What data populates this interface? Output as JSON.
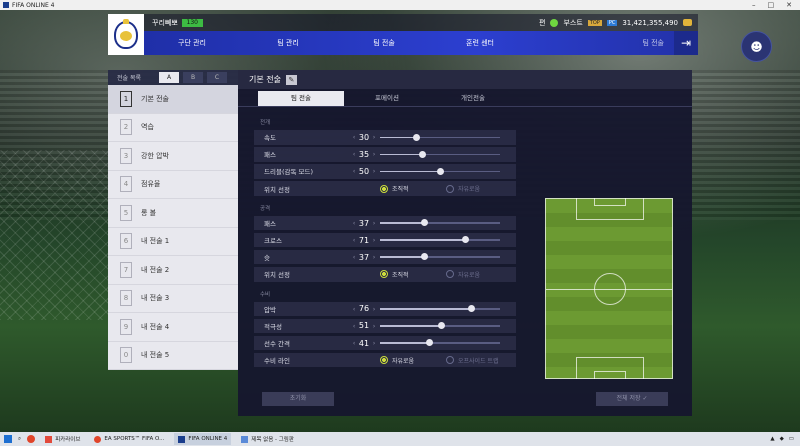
{
  "window": {
    "title": "FIFA ONLINE 4"
  },
  "topbar": {
    "club_name": "꾸리뻬뽀",
    "level": "130",
    "user": "편",
    "boost_label": "부스트",
    "top_badge": "TOP",
    "pc_badge": "PC",
    "currency": "31,421,355,490"
  },
  "nav": {
    "items": [
      "구단 관리",
      "팀 관리",
      "팀 전술",
      "훈련 센터"
    ],
    "subtitle": "팀 전술"
  },
  "tactic_list": {
    "header": "전술 목록",
    "slots": [
      "A",
      "B",
      "C"
    ],
    "active_slot": "A",
    "items": [
      {
        "num": "1",
        "label": "기본 전술"
      },
      {
        "num": "2",
        "label": "역습"
      },
      {
        "num": "3",
        "label": "강한 압박"
      },
      {
        "num": "4",
        "label": "점유율"
      },
      {
        "num": "5",
        "label": "롱 볼"
      },
      {
        "num": "6",
        "label": "내 전술 1"
      },
      {
        "num": "7",
        "label": "내 전술 2"
      },
      {
        "num": "8",
        "label": "내 전술 3"
      },
      {
        "num": "9",
        "label": "내 전술 4"
      },
      {
        "num": "0",
        "label": "내 전술 5"
      }
    ]
  },
  "panel": {
    "title": "기본 전술",
    "tabs": [
      "팀 전술",
      "포메이션",
      "개인전술"
    ],
    "sections": {
      "general": {
        "title": "전개",
        "rows": [
          {
            "label": "속도",
            "value": "30",
            "pct": 0.3
          },
          {
            "label": "패스",
            "value": "35",
            "pct": 0.35
          },
          {
            "label": "드리블(감독 모드)",
            "value": "50",
            "pct": 0.5
          }
        ],
        "position_label": "위치 선정",
        "option_a": "조직적",
        "option_b": "자유로움"
      },
      "attack": {
        "title": "공격",
        "rows": [
          {
            "label": "패스",
            "value": "37",
            "pct": 0.37
          },
          {
            "label": "크로스",
            "value": "71",
            "pct": 0.71
          },
          {
            "label": "슛",
            "value": "37",
            "pct": 0.37
          }
        ],
        "position_label": "위치 선정",
        "option_a": "조직적",
        "option_b": "자유로움"
      },
      "defense": {
        "title": "수비",
        "rows": [
          {
            "label": "압박",
            "value": "76",
            "pct": 0.76
          },
          {
            "label": "적극성",
            "value": "51",
            "pct": 0.51
          },
          {
            "label": "선수 간격",
            "value": "41",
            "pct": 0.41
          }
        ],
        "position_label": "수비 라인",
        "option_a": "자유로움",
        "option_b": "오프사이드 트랩"
      }
    },
    "reset_label": "초기화",
    "save_label": "전체 저장"
  },
  "taskbar": {
    "items": [
      "피카라이브",
      "EA SPORTS™ FIFA O...",
      "FIFA ONLINE 4",
      "제목 없음 - 그림판"
    ]
  }
}
